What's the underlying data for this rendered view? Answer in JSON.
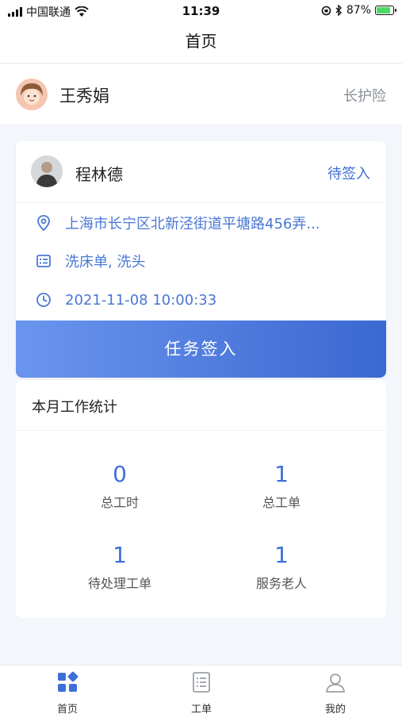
{
  "status_bar": {
    "carrier": "中国联通",
    "time": "11:39",
    "battery": "87%"
  },
  "nav": {
    "title": "首页"
  },
  "user": {
    "name": "王秀娟",
    "insurance": "长护险"
  },
  "task": {
    "worker_name": "程林德",
    "status": "待签入",
    "address": "上海市长宁区北新泾街道平塘路456弄...",
    "services": "洗床单, 洗头",
    "datetime": "2021-11-08 10:00:33",
    "checkin_label": "任务签入"
  },
  "stats": {
    "title": "本月工作统计",
    "items": [
      {
        "value": "0",
        "label": "总工时"
      },
      {
        "value": "1",
        "label": "总工单"
      },
      {
        "value": "1",
        "label": "待处理工单"
      },
      {
        "value": "1",
        "label": "服务老人"
      }
    ]
  },
  "tabs": [
    {
      "label": "首页",
      "icon": "home-grid-icon",
      "active": true
    },
    {
      "label": "工单",
      "icon": "list-document-icon",
      "active": false
    },
    {
      "label": "我的",
      "icon": "person-icon",
      "active": false
    }
  ],
  "colors": {
    "accent": "#3e6fd6",
    "button_start": "#6a95ee",
    "button_end": "#3b68d2",
    "background": "#f3f6fa"
  }
}
